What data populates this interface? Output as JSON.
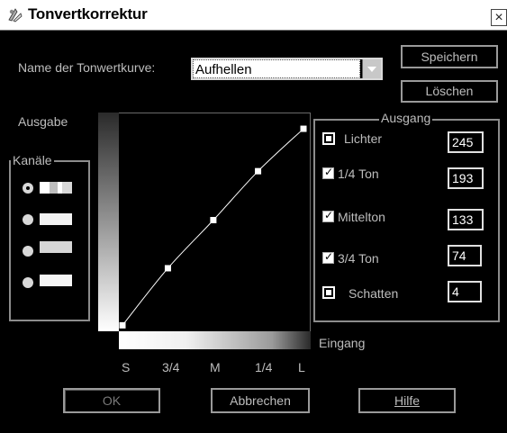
{
  "window": {
    "title": "Tonvertkorrektur",
    "close_glyph": "×"
  },
  "curve_name": {
    "label": "Name der Tonwertkurve:",
    "value": "Aufhellen"
  },
  "buttons": {
    "save": "Speichern",
    "delete": "Löschen",
    "ok": "OK",
    "cancel": "Abbrechen",
    "help": "Hilfe"
  },
  "axis": {
    "output_label": "Ausgabe",
    "input_label": "Eingang",
    "input_ticks": [
      "S",
      "3/4",
      "M",
      "1/4",
      "L"
    ]
  },
  "channels": {
    "title": "Kanäle",
    "selected_index": 0,
    "swatches": [
      "mixed",
      "white",
      "light-gray",
      "white"
    ]
  },
  "output": {
    "title": "Ausgang",
    "rows": [
      {
        "label": "Lichter",
        "value": "245",
        "control": "square"
      },
      {
        "label": "1/4 Ton",
        "value": "193",
        "control": "checkbox",
        "checked": true
      },
      {
        "label": "Mittelton",
        "value": "133",
        "control": "checkbox",
        "checked": true
      },
      {
        "label": "3/4 Ton",
        "value": "74",
        "control": "checkbox",
        "checked": true
      },
      {
        "label": "Schatten",
        "value": "4",
        "control": "square"
      }
    ]
  },
  "curve_points": [
    {
      "input": 0,
      "output": 4
    },
    {
      "input": 64,
      "output": 74
    },
    {
      "input": 128,
      "output": 133
    },
    {
      "input": 191,
      "output": 193
    },
    {
      "input": 255,
      "output": 245
    }
  ],
  "colors": {
    "background": "#000000",
    "text": "#bdbdbd",
    "curve": "#ffffff",
    "title_bar": "#ffffff"
  }
}
